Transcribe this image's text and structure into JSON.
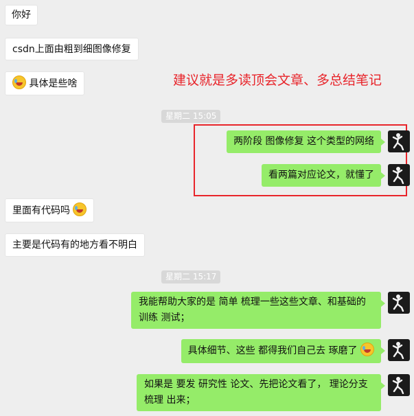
{
  "messages": {
    "m1": "你好",
    "m2": "csdn上面由粗到细图像修复",
    "m3": "具体是些啥",
    "m4": "两阶段  图像修复  这个类型的网络",
    "m5": "看两篇对应论文，就懂了",
    "m6": "里面有代码吗",
    "m7": "主要是代码有的地方看不明白",
    "m8": "我能帮助大家的是 简单 梳理一些这些文章、和基础的训练 测试；",
    "m9": "具体细节、这些 都得我们自己去 琢磨了",
    "m10": "如果是 要发 研究性 论文、先把论文看了， 理论分支 梳理 出来；"
  },
  "timestamps": {
    "t1": "星期二 15:05",
    "t2": "星期二 15:17"
  },
  "annotation": "建议就是多读顶会文章、多总结笔记",
  "colors": {
    "background": "#eeeeee",
    "bubble_sent": "#95ec69",
    "bubble_received": "#ffffff",
    "annotation": "#e8242a"
  },
  "icons": {
    "emoji": "facepalm-laugh-emoji",
    "avatar": "dancer-avatar"
  }
}
